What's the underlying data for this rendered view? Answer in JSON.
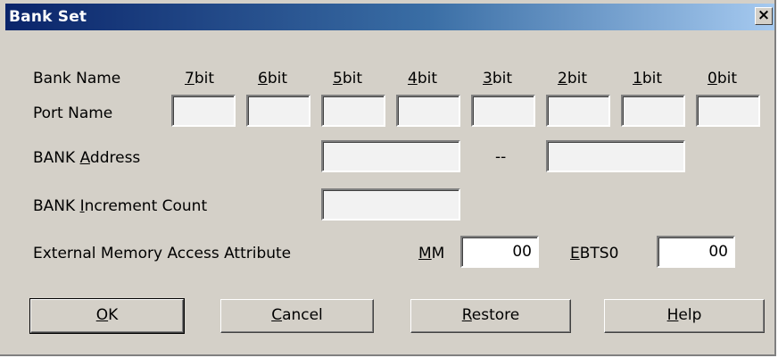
{
  "window": {
    "title": "Bank Set",
    "close_glyph": "×"
  },
  "bank_name": {
    "label": "Bank Name",
    "bits": [
      {
        "key": "7",
        "rest": "bit"
      },
      {
        "key": "6",
        "rest": "bit"
      },
      {
        "key": "5",
        "rest": "bit"
      },
      {
        "key": "4",
        "rest": "bit"
      },
      {
        "key": "3",
        "rest": "bit"
      },
      {
        "key": "2",
        "rest": "bit"
      },
      {
        "key": "1",
        "rest": "bit"
      },
      {
        "key": "0",
        "rest": "bit"
      }
    ]
  },
  "port_name": {
    "label": "Port Name",
    "values": [
      "",
      "",
      "",
      "",
      "",
      "",
      "",
      ""
    ]
  },
  "bank_address": {
    "pre": "BANK ",
    "key": "A",
    "rest": "ddress",
    "from": "",
    "separator": "--",
    "to": ""
  },
  "bank_increment": {
    "pre": "BANK ",
    "key": "I",
    "rest": "ncrement Count",
    "value": ""
  },
  "ext_mem": {
    "label": "External Memory Access Attribute",
    "mm": {
      "key": "M",
      "rest": "M",
      "value": "00"
    },
    "ebts": {
      "key": "E",
      "rest": "BTS0",
      "value": "00"
    }
  },
  "buttons": {
    "ok": {
      "key": "O",
      "rest": "K"
    },
    "cancel": {
      "key": "C",
      "rest": "ancel"
    },
    "restore": {
      "key": "R",
      "rest": "estore"
    },
    "help": {
      "key": "H",
      "rest": "elp"
    }
  }
}
